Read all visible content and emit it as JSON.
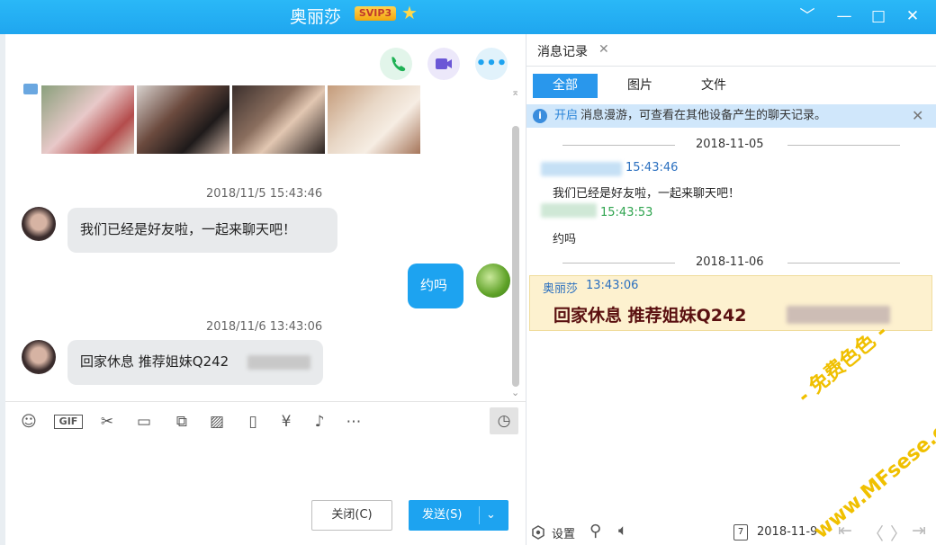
{
  "window": {
    "title": "奥丽莎",
    "vip_badge": "SVIP3"
  },
  "chat": {
    "messages": [
      {
        "timestamp": "2018/11/5 15:43:46",
        "text": "我们已经是好友啦，一起来聊天吧！"
      },
      {
        "text": "约吗"
      },
      {
        "timestamp": "2018/11/6 13:43:06",
        "text": "回家休息 推荐姐妹Q242"
      }
    ]
  },
  "composer": {
    "close_label": "关闭(C)",
    "send_label": "发送(S)"
  },
  "history": {
    "tab_label": "消息记录",
    "filter_tabs": [
      "全部",
      "图片",
      "文件"
    ],
    "info_link": "开启",
    "info_text": "消息漫游，可查看在其他设备产生的聊天记录。",
    "date1": "2018-11-05",
    "rec1_time": "15:43:46",
    "rec1_text": "我们已经是好友啦，一起来聊天吧！",
    "rec2_time": "15:43:53",
    "rec2_text": "约吗",
    "date2": "2018-11-06",
    "rec3_sender": "奥丽莎",
    "rec3_time": "13:43:06",
    "rec3_text": "回家休息 推荐姐妹Q242",
    "settings_label": "设置",
    "footer_date": "2018-11-9"
  },
  "watermark": {
    "line1": "- 免费色色 -",
    "line2": "www.MFsese.com"
  },
  "colors": {
    "accent": "#1da3f0",
    "titlebar": "#22adf3",
    "highlight": "#fdf1cf"
  }
}
